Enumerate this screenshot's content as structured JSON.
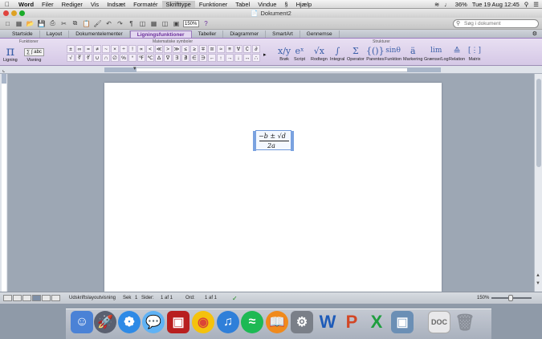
{
  "menubar": {
    "apple": "",
    "items": [
      "Word",
      "Filer",
      "Rediger",
      "Vis",
      "Indsæt",
      "Formatér",
      "Skrifttype",
      "Funktioner",
      "Tabel",
      "Vindue",
      "Hjælp"
    ],
    "highlighted": "Skrifttype",
    "battery": "36%",
    "clock": "Tue 19 Aug  12:45"
  },
  "window": {
    "title": "Dokument2"
  },
  "toolbar": {
    "zoom": "150%",
    "search_placeholder": "Søg i dokument"
  },
  "ribbon": {
    "tabs": [
      "Startside",
      "Layout",
      "Dokumentelementer",
      "Ligningsfunktioner",
      "Tabeller",
      "Diagrammer",
      "SmartArt",
      "Gennemse"
    ],
    "active_tab": "Ligningsfunktioner",
    "group_headers": {
      "functions": "Funktioner",
      "math_symbols": "Matematiske symboler",
      "structures": "Strukturer"
    },
    "left_buttons": {
      "ligning": "Ligning",
      "visning": "Visning"
    },
    "symbols": [
      "±",
      "∞",
      "=",
      "≠",
      "~",
      "×",
      "÷",
      "!",
      "∝",
      "<",
      "≪",
      ">",
      "≫",
      "≤",
      "≥",
      "∓",
      "≅",
      "≈",
      "≡",
      "∀",
      "∁",
      "∂",
      "√",
      "∛",
      "∜",
      "∪",
      "∩",
      "∅",
      "%",
      "°",
      "℉",
      "℃",
      "∆",
      "∇",
      "∃",
      "∄",
      "∈",
      "∋",
      "←",
      "↑",
      "→",
      "↓",
      "↔",
      "∴"
    ],
    "structures": [
      {
        "label": "Brøk",
        "glyph": "x/y"
      },
      {
        "label": "Script",
        "glyph": "eˣ"
      },
      {
        "label": "Rodtegn",
        "glyph": "√x"
      },
      {
        "label": "Integral",
        "glyph": "∫"
      },
      {
        "label": "Operator",
        "glyph": "Σ"
      },
      {
        "label": "Parentes",
        "glyph": "{()}"
      },
      {
        "label": "Funktion",
        "glyph": "sinθ"
      },
      {
        "label": "Markering",
        "glyph": "ä"
      },
      {
        "label": "Grænse/Log",
        "glyph": "lim"
      },
      {
        "label": "Relation",
        "glyph": "≙"
      },
      {
        "label": "Matrix",
        "glyph": "[⋮]"
      }
    ]
  },
  "equation": {
    "numerator": "−b ± √d",
    "denominator": "2a"
  },
  "statusbar": {
    "view_label": "Udskriftslayoutvisning",
    "section_label": "Sek",
    "section_value": "1",
    "pages_label": "Sider:",
    "pages_value": "1 af 1",
    "words_label": "Ord:",
    "words_value": "1 af 1",
    "zoom": "150%"
  },
  "dock": {
    "apps": [
      "Finder",
      "Launchpad",
      "Safari",
      "Messages",
      "Photo Booth",
      "Chrome",
      "iTunes",
      "Spotify",
      "iBooks",
      "System Preferences",
      "Word",
      "PowerPoint",
      "Excel",
      "Preview",
      "Documents",
      "Trash"
    ]
  }
}
